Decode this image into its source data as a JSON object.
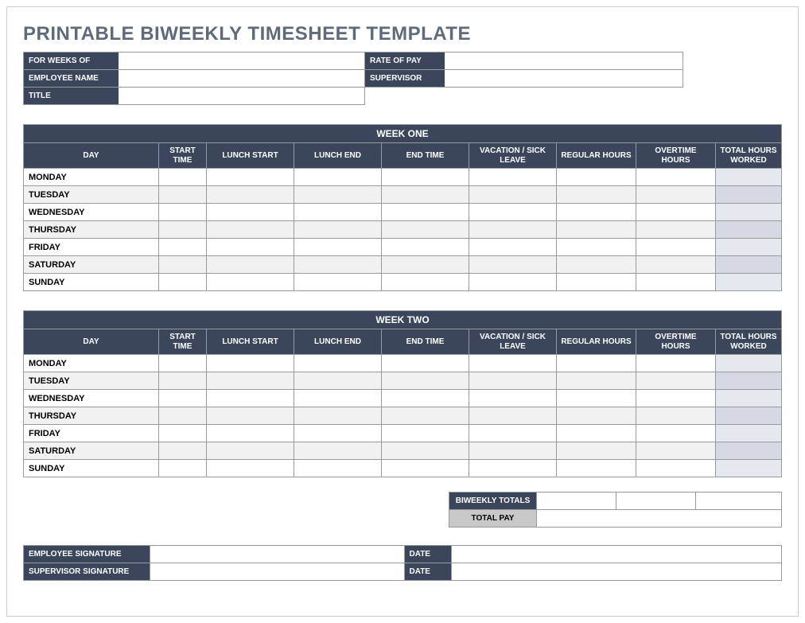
{
  "title": "PRINTABLE BIWEEKLY TIMESHEET TEMPLATE",
  "header": {
    "for_weeks_of_label": "FOR WEEKS OF",
    "for_weeks_of": "",
    "rate_of_pay_label": "RATE OF PAY",
    "rate_of_pay": "",
    "employee_name_label": "EMPLOYEE NAME",
    "employee_name": "",
    "supervisor_label": "SUPERVISOR",
    "supervisor": "",
    "title_label": "TITLE",
    "title": ""
  },
  "columns": {
    "day": "DAY",
    "start_time": "START TIME",
    "lunch_start": "LUNCH START",
    "lunch_end": "LUNCH END",
    "end_time": "END TIME",
    "vacation_sick": "VACATION / SICK LEAVE",
    "regular_hours": "REGULAR HOURS",
    "overtime_hours": "OVERTIME HOURS",
    "total_hours": "TOTAL HOURS WORKED"
  },
  "week_one": {
    "title": "WEEK ONE",
    "rows": [
      {
        "day": "MONDAY",
        "start": "",
        "lunch_start": "",
        "lunch_end": "",
        "end": "",
        "vac": "",
        "reg": "",
        "ot": "",
        "total": ""
      },
      {
        "day": "TUESDAY",
        "start": "",
        "lunch_start": "",
        "lunch_end": "",
        "end": "",
        "vac": "",
        "reg": "",
        "ot": "",
        "total": ""
      },
      {
        "day": "WEDNESDAY",
        "start": "",
        "lunch_start": "",
        "lunch_end": "",
        "end": "",
        "vac": "",
        "reg": "",
        "ot": "",
        "total": ""
      },
      {
        "day": "THURSDAY",
        "start": "",
        "lunch_start": "",
        "lunch_end": "",
        "end": "",
        "vac": "",
        "reg": "",
        "ot": "",
        "total": ""
      },
      {
        "day": "FRIDAY",
        "start": "",
        "lunch_start": "",
        "lunch_end": "",
        "end": "",
        "vac": "",
        "reg": "",
        "ot": "",
        "total": ""
      },
      {
        "day": "SATURDAY",
        "start": "",
        "lunch_start": "",
        "lunch_end": "",
        "end": "",
        "vac": "",
        "reg": "",
        "ot": "",
        "total": ""
      },
      {
        "day": "SUNDAY",
        "start": "",
        "lunch_start": "",
        "lunch_end": "",
        "end": "",
        "vac": "",
        "reg": "",
        "ot": "",
        "total": ""
      }
    ]
  },
  "week_two": {
    "title": "WEEK TWO",
    "rows": [
      {
        "day": "MONDAY",
        "start": "",
        "lunch_start": "",
        "lunch_end": "",
        "end": "",
        "vac": "",
        "reg": "",
        "ot": "",
        "total": ""
      },
      {
        "day": "TUESDAY",
        "start": "",
        "lunch_start": "",
        "lunch_end": "",
        "end": "",
        "vac": "",
        "reg": "",
        "ot": "",
        "total": ""
      },
      {
        "day": "WEDNESDAY",
        "start": "",
        "lunch_start": "",
        "lunch_end": "",
        "end": "",
        "vac": "",
        "reg": "",
        "ot": "",
        "total": ""
      },
      {
        "day": "THURSDAY",
        "start": "",
        "lunch_start": "",
        "lunch_end": "",
        "end": "",
        "vac": "",
        "reg": "",
        "ot": "",
        "total": ""
      },
      {
        "day": "FRIDAY",
        "start": "",
        "lunch_start": "",
        "lunch_end": "",
        "end": "",
        "vac": "",
        "reg": "",
        "ot": "",
        "total": ""
      },
      {
        "day": "SATURDAY",
        "start": "",
        "lunch_start": "",
        "lunch_end": "",
        "end": "",
        "vac": "",
        "reg": "",
        "ot": "",
        "total": ""
      },
      {
        "day": "SUNDAY",
        "start": "",
        "lunch_start": "",
        "lunch_end": "",
        "end": "",
        "vac": "",
        "reg": "",
        "ot": "",
        "total": ""
      }
    ]
  },
  "totals": {
    "biweekly_totals_label": "BIWEEKLY TOTALS",
    "biweekly_reg": "",
    "biweekly_ot": "",
    "biweekly_total": "",
    "total_pay_label": "TOTAL PAY",
    "total_pay": ""
  },
  "signatures": {
    "employee_sig_label": "EMPLOYEE SIGNATURE",
    "employee_sig": "",
    "supervisor_sig_label": "SUPERVISOR SIGNATURE",
    "supervisor_sig": "",
    "date_label": "DATE",
    "employee_date": "",
    "supervisor_date": ""
  }
}
